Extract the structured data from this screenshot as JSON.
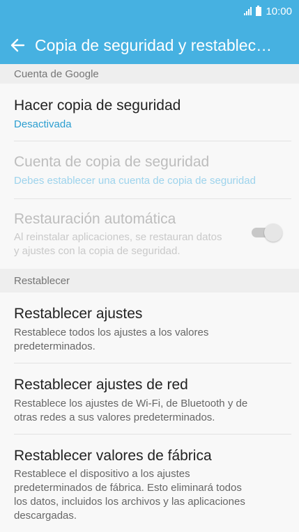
{
  "status": {
    "time": "10:00"
  },
  "header": {
    "title": "Copia de seguridad y restablecim..."
  },
  "sections": {
    "google": "Cuenta de Google",
    "reset": "Restablecer"
  },
  "items": {
    "backup": {
      "title": "Hacer copia de seguridad",
      "subtitle": "Desactivada"
    },
    "backup_account": {
      "title": "Cuenta de copia de seguridad",
      "subtitle": "Debes establecer una cuenta de copia de seguridad"
    },
    "auto_restore": {
      "title": "Restauración automática",
      "line1": "Al reinstalar aplicaciones, se restauran datos",
      "line2": "y ajustes con la copia de seguridad.",
      "toggle_on": true
    },
    "reset_settings": {
      "title": "Restablecer ajustes",
      "line1": "Restablece todos los ajustes a los valores",
      "line2": "predeterminados."
    },
    "reset_network": {
      "title": "Restablecer ajustes de red",
      "line1": "Restablece los ajustes de Wi-Fi, de Bluetooth y de",
      "line2": "otras redes a sus valores predeterminados."
    },
    "factory_reset": {
      "title": "Restablecer valores de fábrica",
      "line1": "Restablece el dispositivo a los ajustes",
      "line2": "predeterminados de fábrica. Esto eliminará todos",
      "line3": "los datos, incluidos los archivos y las aplicaciones",
      "line4": "descargadas."
    }
  },
  "colors": {
    "appbar": "#46b1e1",
    "accent": "#2c9ed0"
  },
  "icons": {
    "back": "arrow-left-icon",
    "signal": "signal-icon",
    "battery": "battery-icon"
  }
}
